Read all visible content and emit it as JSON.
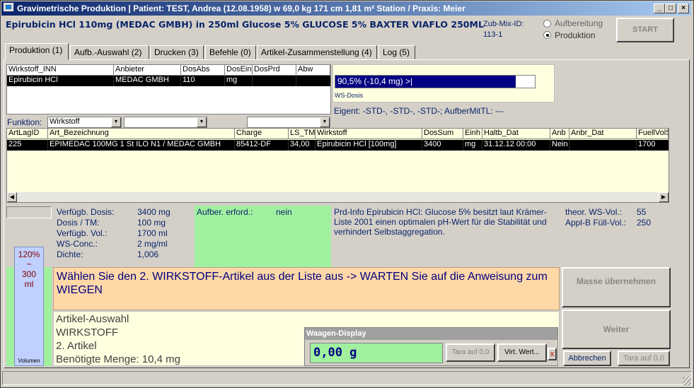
{
  "window": {
    "title": "Gravimetrische Produktion  |  Patient: TEST, Andrea (12.08.1958) w 69,0 kg  171 cm  1,81 m² Station / Praxis: Meier",
    "min": "_",
    "max": "□",
    "close": "×"
  },
  "header": {
    "product": "Epirubicin HCl 110mg (MEDAC GMBH) in 250ml Glucose 5% GLUCOSE 5% BAXTER VIAFLO 250ML",
    "zub_label": "Zub-Mix-ID:",
    "zub_value": "113-1",
    "radio_1": "Aufbereitung",
    "radio_2": "Produktion",
    "start": "START"
  },
  "tabs": [
    "Produktion (1)",
    "Aufb.-Auswahl (2)",
    "Drucken (3)",
    "Befehle (0)",
    "Artikel-Zusammenstellung (4)",
    "Log (5)"
  ],
  "top_grid": {
    "headers": [
      "Wirkstoff_INN",
      "Anbieter",
      "DosAbs",
      "DosEin",
      "DosPrd",
      "Abw"
    ],
    "row": [
      "Epirubicin HCl",
      "MEDAC GMBH",
      "110",
      "mg",
      "",
      ""
    ]
  },
  "dose_box": {
    "bar_text": "90,5%  (-10,4 mg)   >|",
    "bar_percent": 90.5,
    "caption": "WS-Dosis"
  },
  "eigent": "Eigent: -STD-, -STD-, -STD-; AufberMitTL: ---",
  "funktion": {
    "label": "Funktion:",
    "value": "Wirkstoff"
  },
  "article_grid": {
    "headers": [
      "ArtLagID",
      "Art_Bezeichnung",
      "Charge",
      "LS_TM",
      "Wirkstoff",
      "DosSum",
      "Einh",
      "Haltb_Dat",
      "Anb",
      "Anbr_Dat",
      "FuellVolS"
    ],
    "row": [
      "225",
      "EPIMEDAC 100MG   1 St ILO N1 / MEDAC GMBH",
      "85412-DF",
      "34,00",
      "Epirubicin HCl [100mg]",
      "3400",
      "mg",
      "31.12.12 00:00",
      "Nein",
      "",
      "1700"
    ]
  },
  "info": {
    "rows": [
      {
        "k": "Verfügb. Dosis:",
        "v": "3400 mg"
      },
      {
        "k": "Dosis / TM:",
        "v": "100 mg"
      },
      {
        "k": "Verfügb. Vol.:",
        "v": "1700 ml"
      },
      {
        "k": "WS-Conc.:",
        "v": "2 mg/ml"
      },
      {
        "k": "Dichte:",
        "v": "1,006"
      }
    ],
    "aufber_label": "Aufber. erford.:",
    "aufber_value": "nein",
    "prd_info": "Prd-Info Epirubicin HCl: Glucose 5% besitzt laut Krämer-Liste 2001 einen optimalen pH-Wert für die Stabilität und verhindert Selbstaggregation.",
    "theor_label": "theor. WS-Vol.:",
    "theor_value": "55",
    "appl_label": "Appl-B Füll-Vol.:",
    "appl_value": "250"
  },
  "volume": {
    "top": "120%",
    "tilde": "~",
    "ml": "300",
    "unit": "ml",
    "label": "Volumen"
  },
  "instruction": "Wählen Sie den 2. WIRKSTOFF-Artikel aus der Liste aus -> WARTEN Sie auf die Anweisung zum WIEGEN",
  "status_lines": [
    "Artikel-Auswahl",
    "WIRKSTOFF",
    "2. Artikel",
    "Benötigte Menge: 10,4 mg"
  ],
  "waage": {
    "title": "Waagen-Display",
    "value": "0,00  g",
    "tara": "Tara auf 0,0",
    "virt": "Virt. Wert...",
    "x": "x"
  },
  "buttons": {
    "masse": "Masse übernehmen",
    "weiter": "Weiter",
    "abbrechen": "Abbrechen",
    "tara": "Tara auf 0,0"
  }
}
